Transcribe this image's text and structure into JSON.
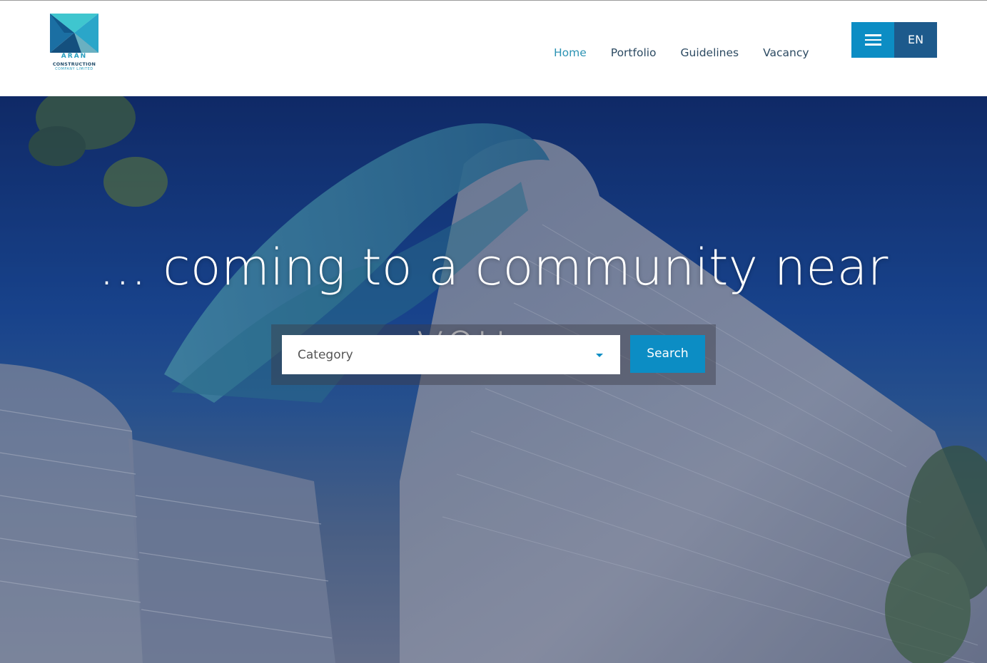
{
  "brand": {
    "name": "ARAN",
    "line2": "CONSTRUCTION",
    "line3": "COMPANY LIMITED"
  },
  "nav": {
    "items": [
      {
        "label": "Home",
        "active": true
      },
      {
        "label": "Portfolio",
        "active": false
      },
      {
        "label": "Guidelines",
        "active": false
      },
      {
        "label": "Vacancy",
        "active": false
      }
    ]
  },
  "header": {
    "menu_icon": "hamburger-menu-icon",
    "language": "EN"
  },
  "hero": {
    "headline": "... coming to a community near you ...",
    "category_placeholder": "Category",
    "search_label": "Search"
  },
  "colors": {
    "accent": "#0c8dc4",
    "nav_text": "#2c4a62",
    "nav_active": "#2c93b4",
    "lang_bg": "#1d5a8c"
  }
}
